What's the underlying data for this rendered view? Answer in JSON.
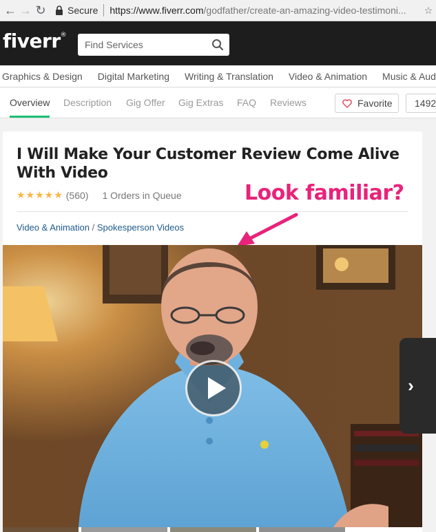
{
  "browser": {
    "secure_label": "Secure",
    "url_host": "https://www.fiverr.com",
    "url_path": "/godfather/create-an-amazing-video-testimoni..."
  },
  "header": {
    "logo": "fiverr",
    "search_placeholder": "Find Services"
  },
  "categories": [
    "Graphics & Design",
    "Digital Marketing",
    "Writing & Translation",
    "Video & Animation",
    "Music & Aud"
  ],
  "tabs": [
    "Overview",
    "Description",
    "Gig Offer",
    "Gig Extras",
    "FAQ",
    "Reviews"
  ],
  "actions": {
    "favorite_label": "Favorite",
    "favorite_count": "1492"
  },
  "gig": {
    "title": "I Will Make Your Customer Review Come Alive With Video",
    "stars": "★★★★★",
    "rating_count": "(560)",
    "queue": "1 Orders in Queue",
    "category": "Video & Animation",
    "separator": " / ",
    "subcategory": "Spokesperson Videos"
  },
  "annotation": "Look familiar?",
  "colors": {
    "brand_green": "#1dbf73",
    "annotation_pink": "#e8237a",
    "star_orange": "#ffb33e",
    "link_blue": "#1d5a8c"
  },
  "icons": [
    "back-arrow-icon",
    "forward-arrow-icon",
    "reload-icon",
    "lock-icon",
    "bookmark-star-icon",
    "search-icon",
    "heart-icon",
    "play-icon",
    "chevron-right-icon"
  ]
}
